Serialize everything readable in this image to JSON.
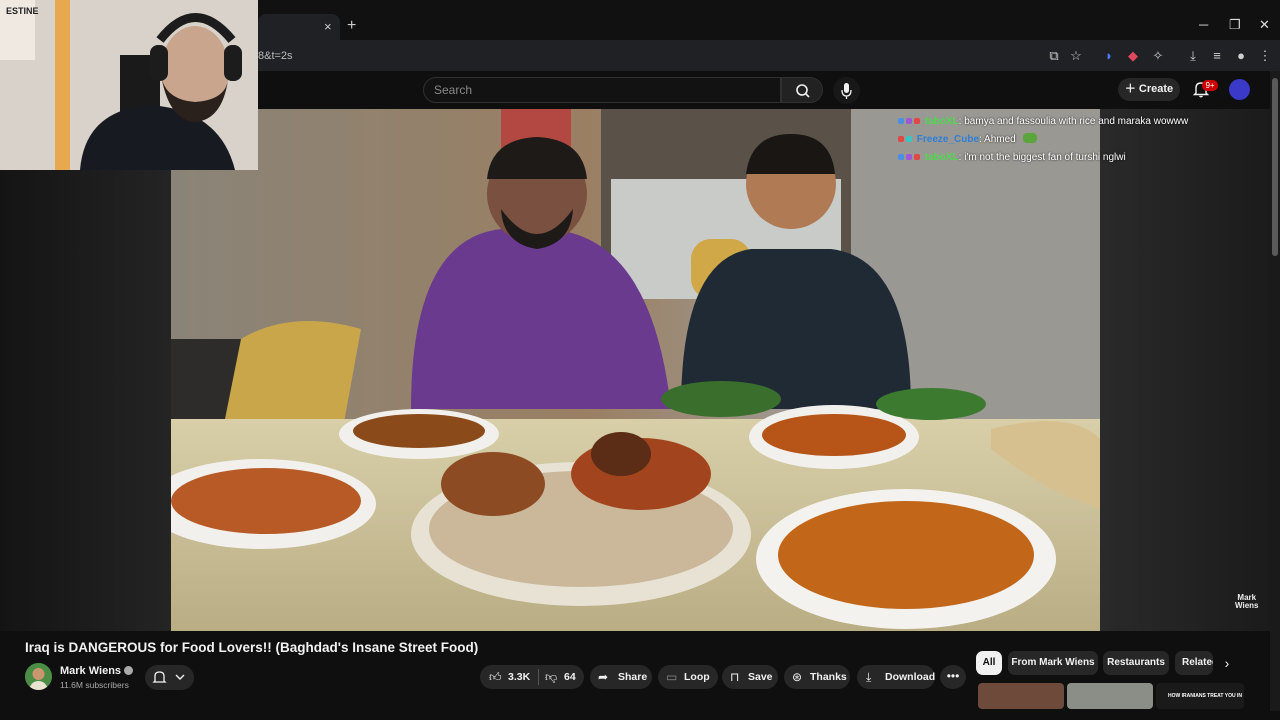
{
  "browser": {
    "url_fragment": "8&t=2s",
    "tab_close": "×",
    "new_tab": "+",
    "window_controls": [
      "─",
      "❐",
      "✕"
    ]
  },
  "header": {
    "search_placeholder": "Search",
    "create_label": "Create",
    "notification_count": "9+"
  },
  "chat": [
    {
      "user": "taboXL",
      "user_color": "#4fd84f",
      "message": "bamya and fassoulia with rice and maraka wowww"
    },
    {
      "user": "Freeze_Cube",
      "user_color": "#2f7fd6",
      "message": "Ahmed"
    },
    {
      "user": "taboXL",
      "user_color": "#4fd84f",
      "message": "i'm not the biggest fan of turshi nglwi"
    }
  ],
  "watermark": {
    "line1": "Mark",
    "line2": "Wiens"
  },
  "video_info": {
    "title": "Iraq is DANGEROUS for Food Lovers!! (Baghdad's Insane Street Food)",
    "channel_name": "Mark Wiens",
    "subscribers": "11.6M subscribers"
  },
  "actions": {
    "like_count": "3.3K",
    "dislike_count": "64",
    "share_label": "Share",
    "loop_label": "Loop",
    "save_label": "Save",
    "thanks_label": "Thanks",
    "download_label": "Download",
    "more_label": "•••"
  },
  "chips": [
    "All",
    "From Mark Wiens",
    "Restaurants",
    "Related"
  ],
  "thumbnail_caption": "HOW IRANIANS TREAT YOU IN",
  "colors": {
    "background": "#0f0f0f",
    "pill": "#272727",
    "accent_red": "#cc0000",
    "chip_active": "#f1f1f1"
  }
}
